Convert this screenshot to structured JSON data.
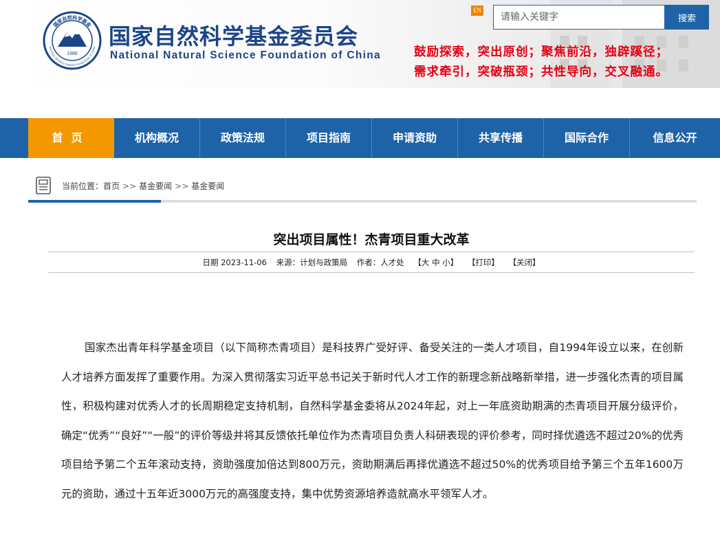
{
  "header": {
    "org_name_cn": "国家自然科学基金委员会",
    "org_name_en": "National Natural Science Foundation of China",
    "seal_year": "1986",
    "seal_text_cn": "国家自然科学基金",
    "seal_text_en": "NATIONAL NATURAL SCIENCE FOUNDATION OF CHINA",
    "lang_switch": "EN",
    "search_placeholder": "请输入关键字",
    "search_button": "搜索",
    "slogan_line1": "鼓励探索，突出原创；聚焦前沿，独辟蹊径；",
    "slogan_line2": "需求牵引，突破瓶颈；共性导向，交叉融通。"
  },
  "nav": {
    "items": [
      {
        "label": "首页"
      },
      {
        "label": "机构概况"
      },
      {
        "label": "政策法规"
      },
      {
        "label": "项目指南"
      },
      {
        "label": "申请资助"
      },
      {
        "label": "共享传播"
      },
      {
        "label": "国际合作"
      },
      {
        "label": "信息公开"
      }
    ]
  },
  "breadcrumb": {
    "prefix": "当前位置：",
    "items": [
      "首页",
      "基金要闻",
      "基金要闻"
    ],
    "separator": ">>"
  },
  "article": {
    "title": "突出项目属性！杰青项目重大改革",
    "date_label": "日期",
    "date": "2023-11-06",
    "source_label": "来源：",
    "source": "计划与政策局",
    "author_label": "作者：",
    "author": "人才处",
    "font_size_controls": "【大 中 小】",
    "print_label": "【打印】",
    "close_label": "【关闭】",
    "paragraph": "国家杰出青年科学基金项目（以下简称杰青项目）是科技界广受好评、备受关注的一类人才项目，自1994年设立以来，在创新人才培养方面发挥了重要作用。为深入贯彻落实习近平总书记关于新时代人才工作的新理念新战略新举措，进一步强化杰青的项目属性，积极构建对优秀人才的长周期稳定支持机制，自然科学基金委将从2024年起，对上一年底资助期满的杰青项目开展分级评价，确定“优秀”“良好”“一般”的评价等级并将其反馈依托单位作为杰青项目负责人科研表现的评价参考，同时择优遴选不超过20%的优秀项目给予第二个五年滚动支持，资助强度加倍达到800万元，资助期满后再择优遴选不超过50%的优秀项目给予第三个五年1600万元的资助，通过十五年近3000万元的高强度支持，集中优势资源培养造就高水平领军人才。"
  },
  "colors": {
    "brand_blue": "#1e63a8",
    "nav_active": "#f39800",
    "slogan_red": "#e60012",
    "logo_blue": "#1c4587"
  }
}
